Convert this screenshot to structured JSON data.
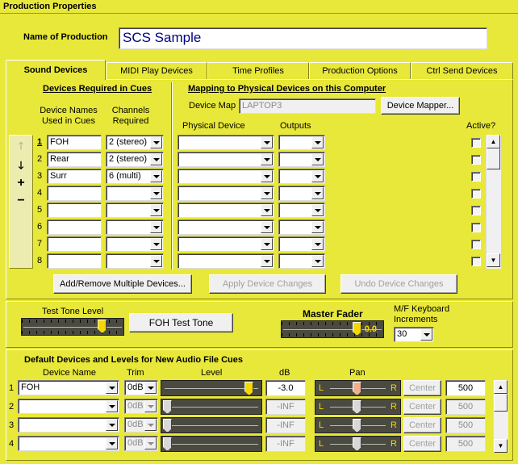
{
  "window": {
    "title": "Production Properties"
  },
  "production": {
    "label": "Name of Production",
    "name": "SCS Sample"
  },
  "tabs": [
    {
      "label": "Sound Devices",
      "active": true
    },
    {
      "label": "MIDI Play Devices"
    },
    {
      "label": "Time Profiles"
    },
    {
      "label": "Production Options"
    },
    {
      "label": "Ctrl Send Devices"
    }
  ],
  "required": {
    "heading": "Devices Required in Cues",
    "col_names": "Device Names\nUsed in Cues",
    "col_channels": "Channels\nRequired",
    "rows": [
      {
        "num": "1",
        "name": "FOH",
        "channels": "2 (stereo)"
      },
      {
        "num": "2",
        "name": "Rear",
        "channels": "2 (stereo)"
      },
      {
        "num": "3",
        "name": "Surr",
        "channels": "6 (multi)"
      },
      {
        "num": "4",
        "name": "",
        "channels": ""
      },
      {
        "num": "5",
        "name": "",
        "channels": ""
      },
      {
        "num": "6",
        "name": "",
        "channels": ""
      },
      {
        "num": "7",
        "name": "",
        "channels": ""
      },
      {
        "num": "8",
        "name": "",
        "channels": ""
      }
    ],
    "side_buttons": {
      "up": "🡑",
      "down": "🡓",
      "add": "+",
      "remove": "−"
    }
  },
  "mapping": {
    "heading": "Mapping to Physical Devices on this Computer",
    "device_map_label": "Device Map",
    "device_map_value": "LAPTOP3",
    "device_mapper_button": "Device Mapper...",
    "col_physical": "Physical Device",
    "col_outputs": "Outputs",
    "col_active": "Active?"
  },
  "actions": {
    "add_remove": "Add/Remove Multiple Devices...",
    "apply": "Apply Device Changes",
    "undo": "Undo Device Changes"
  },
  "test": {
    "tone_label": "Test Tone Level",
    "tone_button": "FOH Test Tone",
    "tone_level": 0.8,
    "master_label": "Master Fader",
    "master_value": "0.0",
    "master_level": 0.75,
    "mf_label": "M/F Keyboard\nIncrements",
    "mf_value": "30"
  },
  "defaults": {
    "heading": "Default Devices and Levels for New Audio File Cues",
    "col_device": "Device Name",
    "col_trim": "Trim",
    "col_level": "Level",
    "col_db": "dB",
    "col_pan": "Pan",
    "pan_left": "L",
    "pan_right": "R",
    "rows": [
      {
        "num": "1",
        "device": "FOH",
        "trim": "0dB",
        "db": "-3.0",
        "pan_value": "500",
        "center": "Center",
        "level": 0.92,
        "enabled": true
      },
      {
        "num": "2",
        "device": "",
        "trim": "0dB",
        "db": "-INF",
        "pan_value": "500",
        "center": "Center",
        "level": 0.0,
        "enabled": false
      },
      {
        "num": "3",
        "device": "",
        "trim": "0dB",
        "db": "-INF",
        "pan_value": "500",
        "center": "Center",
        "level": 0.0,
        "enabled": false
      },
      {
        "num": "4",
        "device": "",
        "trim": "0dB",
        "db": "-INF",
        "pan_value": "500",
        "center": "Center",
        "level": 0.0,
        "enabled": false
      }
    ]
  },
  "colors": {
    "background": "#e8e83a",
    "title_text": "#000080",
    "thumb": "#f5d800",
    "pan_thumb": "#f0b090"
  }
}
